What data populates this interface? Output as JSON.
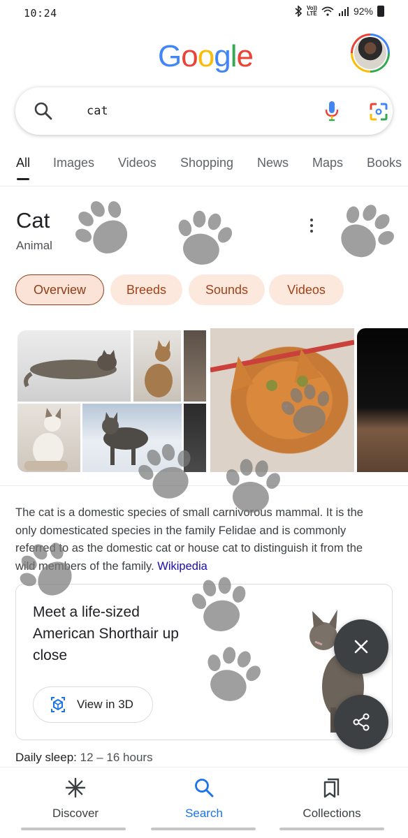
{
  "status_bar": {
    "time": "10:24",
    "network_label_top": "Vo))",
    "network_label_bottom": "LTE",
    "battery": "92%",
    "icons": [
      "bluetooth-icon",
      "wifi-icon",
      "signal-icon",
      "battery-icon"
    ]
  },
  "logo": {
    "letters": [
      "G",
      "o",
      "o",
      "g",
      "l",
      "e"
    ],
    "colors": [
      "#4285f4",
      "#ea4335",
      "#fbbc05",
      "#4285f4",
      "#34a853",
      "#ea4335"
    ]
  },
  "search": {
    "query": "cat",
    "icons": [
      "search-icon",
      "mic-icon",
      "lens-icon"
    ]
  },
  "tabs": [
    {
      "label": "All",
      "active": true
    },
    {
      "label": "Images",
      "active": false
    },
    {
      "label": "Videos",
      "active": false
    },
    {
      "label": "Shopping",
      "active": false
    },
    {
      "label": "News",
      "active": false
    },
    {
      "label": "Maps",
      "active": false
    },
    {
      "label": "Books",
      "active": false
    }
  ],
  "knowledge_panel": {
    "title": "Cat",
    "subtitle": "Animal",
    "chips": [
      {
        "label": "Overview",
        "selected": true
      },
      {
        "label": "Breeds",
        "selected": false
      },
      {
        "label": "Sounds",
        "selected": false
      },
      {
        "label": "Videos",
        "selected": false
      }
    ],
    "description": "The cat is a domestic species of small carnivorous mammal. It is the only domesticated species in the family Felidae and is commonly referred to as the domestic cat or house cat to distinguish it from the wild members of the family.",
    "source": "Wikipedia"
  },
  "card_3d": {
    "headline": "Meet a life-sized American Shorthair up close",
    "button_label": "View in 3D"
  },
  "facts": {
    "sleep_label": "Daily sleep:",
    "sleep_value": "12 – 16 hours"
  },
  "bottom_nav": [
    {
      "label": "Discover",
      "icon": "asterisk-icon",
      "active": false
    },
    {
      "label": "Search",
      "icon": "search-icon",
      "active": true
    },
    {
      "label": "Collections",
      "icon": "bookmark-icon",
      "active": false
    }
  ],
  "accent_colors": {
    "link": "#1a0dab",
    "active_nav": "#1a73e8",
    "chip_bg": "#fce8dc",
    "chip_text": "#a1421a",
    "fab": "#3c4043",
    "paw_overlay": "#7a7a7a"
  }
}
